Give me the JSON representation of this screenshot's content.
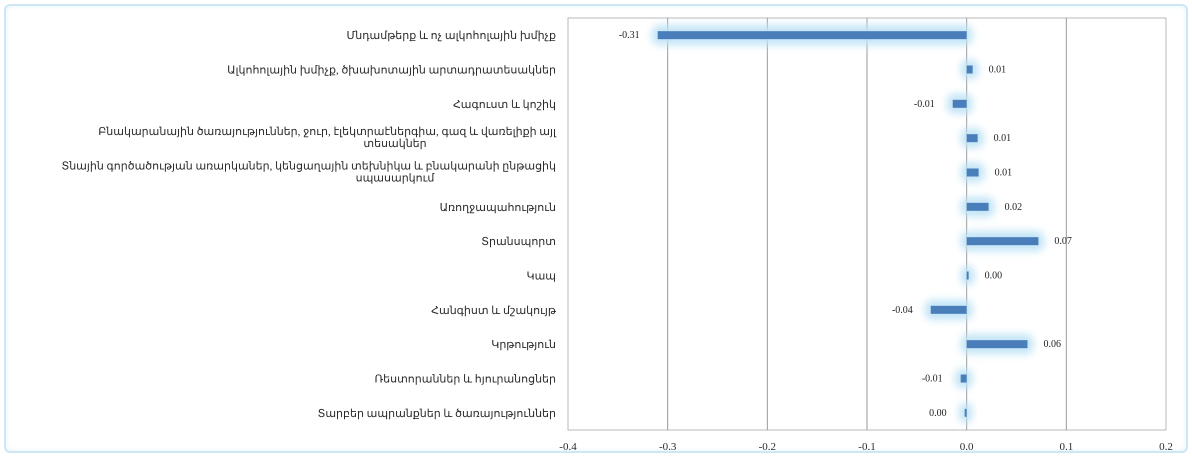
{
  "chart_data": {
    "type": "bar",
    "orientation": "horizontal",
    "categories": [
      "Մնդամթերք և ոչ ալկոհոլային խմիչք",
      "Ալկոհոլային խմիչք, ծխախոտային արտադրատեսակներ",
      "Հագուստ և կոշիկ",
      [
        "Բնակարանային ծառայություններ, ջուր, էլեկտրաէներգիա, գազ և վառելիքի այլ",
        "տեսակներ"
      ],
      [
        "Տնային գործածության առարկաներ, կենցաղային տեխնիկա և բնակարանի ընթացիկ",
        "սպասարկում"
      ],
      "Առողջապահություն",
      "Տրանսպորտ",
      "Կապ",
      "Հանգիստ և մշակույթ",
      "Կրթություն",
      "Ռեստորաններ և հյուրանոցներ",
      "Տարբեր ապրանքներ և ծառայություններ"
    ],
    "values": [
      -0.31,
      0.006,
      -0.014,
      0.011,
      0.012,
      0.022,
      0.072,
      0.002,
      -0.036,
      0.061,
      -0.006,
      -0.002
    ],
    "data_labels": [
      "-0.31",
      "0.01",
      "-0.01",
      "0.01",
      "0.01",
      "0.02",
      "0.07",
      "0.00",
      "-0.04",
      "0.06",
      "-0.01",
      "0.00"
    ],
    "xlim": [
      -0.4,
      0.2
    ],
    "xticks": [
      "-0.4",
      "-0.3",
      "-0.2",
      "-0.1",
      "0.0",
      "0.1",
      "0.2"
    ],
    "xtick_values": [
      -0.4,
      -0.3,
      -0.2,
      -0.1,
      0.0,
      0.1,
      0.2
    ],
    "grid": true,
    "legend": "none",
    "bar_color": "#4a7ebb",
    "glow_color": "#bfe3f6",
    "title": "",
    "xlabel": "",
    "ylabel": ""
  }
}
